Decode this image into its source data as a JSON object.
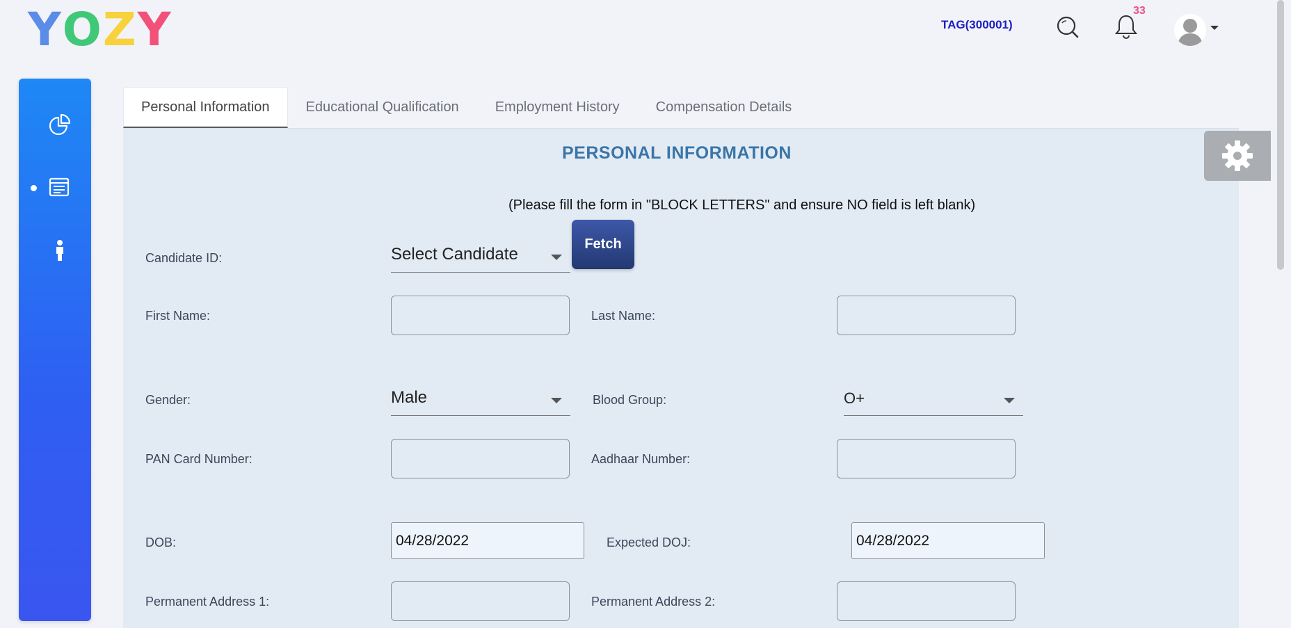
{
  "header": {
    "logo_letters": [
      {
        "char": "Y",
        "color": "#5b8de8"
      },
      {
        "char": "O",
        "color": "#3fc878"
      },
      {
        "char": "Z",
        "color": "#f7d23c"
      },
      {
        "char": "Y",
        "color": "#f2527a"
      }
    ],
    "tag": "TAG(300001)",
    "notification_count": "33"
  },
  "sidebar": {
    "items": [
      {
        "icon": "pie-chart-icon"
      },
      {
        "icon": "form-list-icon",
        "active": true
      },
      {
        "icon": "person-icon"
      }
    ]
  },
  "tabs": [
    {
      "label": "Personal Information",
      "active": true
    },
    {
      "label": "Educational Qualification"
    },
    {
      "label": "Employment History"
    },
    {
      "label": "Compensation Details"
    }
  ],
  "form": {
    "heading": "PERSONAL INFORMATION",
    "note": "(Please fill the form in \"BLOCK LETTERS\" and ensure NO field is left blank)",
    "candidate_label": "Candidate ID:",
    "candidate_value": "Select Candidate",
    "fetch_label": "Fetch",
    "first_name_label": "First Name:",
    "first_name_value": "",
    "last_name_label": "Last Name:",
    "last_name_value": "",
    "gender_label": "Gender:",
    "gender_value": "Male",
    "blood_label": "Blood Group:",
    "blood_value": "O+",
    "pan_label": "PAN Card Number:",
    "pan_value": "",
    "aadhaar_label": "Aadhaar Number:",
    "aadhaar_value": "",
    "dob_label": "DOB:",
    "dob_value": "04/28/2022",
    "doj_label": "Expected DOJ:",
    "doj_value": "04/28/2022",
    "addr1_label": "Permanent Address 1:",
    "addr1_value": "",
    "addr2_label": "Permanent Address 2:",
    "addr2_value": ""
  },
  "colors": {
    "sidebar_gradient_top": "#1e88f5",
    "sidebar_gradient_bottom": "#3a56f0",
    "heading": "#3a75a8",
    "tag": "#1a1fc0",
    "badge": "#ea4e8a",
    "fetch_button": "#2e457f"
  }
}
